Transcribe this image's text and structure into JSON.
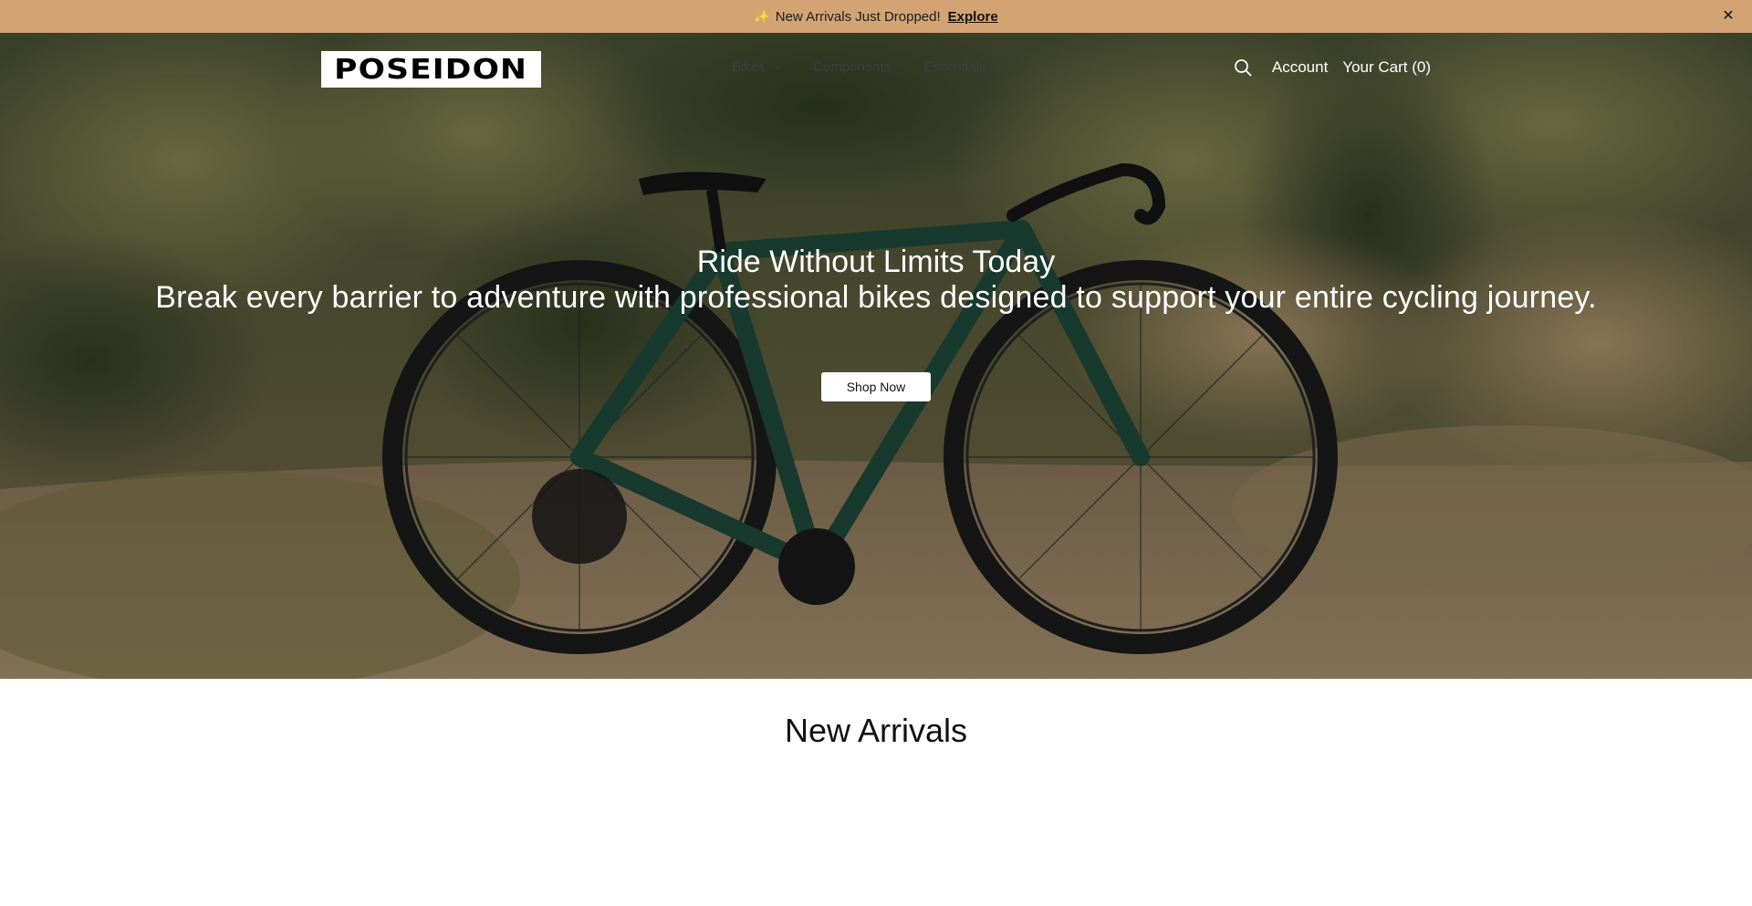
{
  "announcement": {
    "icon": "sparkle-icon",
    "message": "New Arrivals Just Dropped!",
    "link_label": "Explore",
    "close_icon": "close-icon",
    "background": "#d4a373"
  },
  "header": {
    "logo_text": "POSEIDON",
    "nav": [
      {
        "label": "Bikes",
        "has_dropdown": true
      },
      {
        "label": "Components",
        "has_dropdown": false
      },
      {
        "label": "Essentials",
        "has_dropdown": true
      }
    ],
    "search_icon": "search-icon",
    "account_label": "Account",
    "cart_label": "Your Cart (0)"
  },
  "hero": {
    "title": "Ride Without Limits Today",
    "subtitle": "Break every barrier to adventure with professional bikes designed to support your entire cycling journey.",
    "cta_label": "Shop Now"
  },
  "new_arrivals": {
    "title": "New Arrivals"
  }
}
